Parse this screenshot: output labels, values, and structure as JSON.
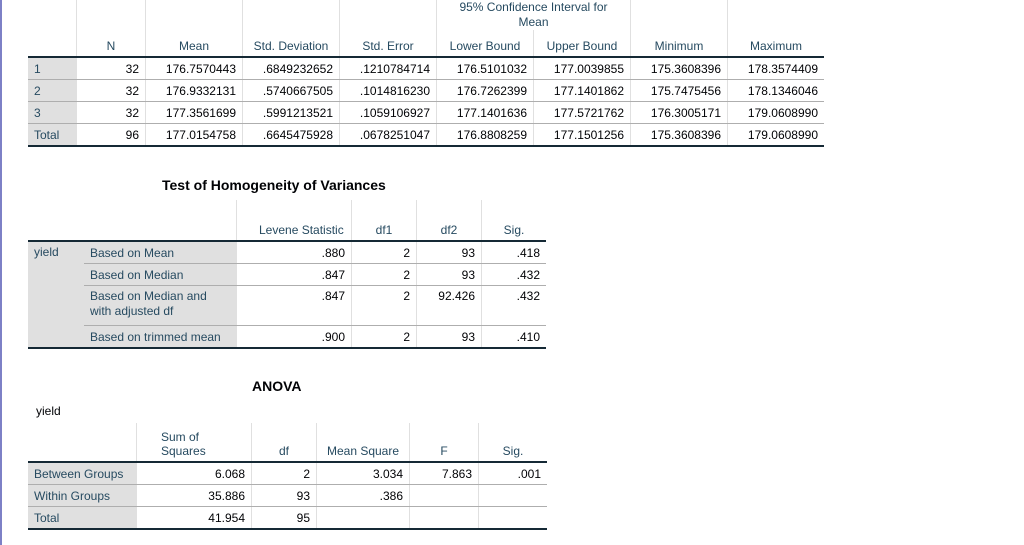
{
  "descriptives": {
    "ci_group_header": "95% Confidence Interval for Mean",
    "columns": [
      "N",
      "Mean",
      "Std. Deviation",
      "Std. Error",
      "Lower Bound",
      "Upper Bound",
      "Minimum",
      "Maximum"
    ],
    "rows": [
      {
        "label": "1",
        "values": [
          "32",
          "176.7570443",
          ".6849232652",
          ".1210784714",
          "176.5101032",
          "177.0039855",
          "175.3608396",
          "178.3574409"
        ]
      },
      {
        "label": "2",
        "values": [
          "32",
          "176.9332131",
          ".5740667505",
          ".1014816230",
          "176.7262399",
          "177.1401862",
          "175.7475456",
          "178.1346046"
        ]
      },
      {
        "label": "3",
        "values": [
          "32",
          "177.3561699",
          ".5991213521",
          ".1059106927",
          "177.1401636",
          "177.5721762",
          "176.3005171",
          "179.0608990"
        ]
      },
      {
        "label": "Total",
        "values": [
          "96",
          "177.0154758",
          ".6645475928",
          ".0678251047",
          "176.8808259",
          "177.1501256",
          "175.3608396",
          "179.0608990"
        ]
      }
    ]
  },
  "homogeneity": {
    "title": "Test of Homogeneity of Variances",
    "columns": [
      "Levene Statistic",
      "df1",
      "df2",
      "Sig."
    ],
    "variable": "yield",
    "rows": [
      {
        "label": "Based on Mean",
        "values": [
          ".880",
          "2",
          "93",
          ".418"
        ]
      },
      {
        "label": "Based on Median",
        "values": [
          ".847",
          "2",
          "93",
          ".432"
        ]
      },
      {
        "label": "Based on Median and with adjusted df",
        "values": [
          ".847",
          "2",
          "92.426",
          ".432"
        ]
      },
      {
        "label": "Based on trimmed mean",
        "values": [
          ".900",
          "2",
          "93",
          ".410"
        ]
      }
    ]
  },
  "anova": {
    "title": "ANOVA",
    "variable": "yield",
    "columns": [
      "Sum of Squares",
      "df",
      "Mean Square",
      "F",
      "Sig."
    ],
    "rows": [
      {
        "label": "Between Groups",
        "values": [
          "6.068",
          "2",
          "3.034",
          "7.863",
          ".001"
        ]
      },
      {
        "label": "Within Groups",
        "values": [
          "35.886",
          "93",
          ".386",
          "",
          ""
        ]
      },
      {
        "label": "Total",
        "values": [
          "41.954",
          "95",
          "",
          "",
          ""
        ]
      }
    ]
  }
}
